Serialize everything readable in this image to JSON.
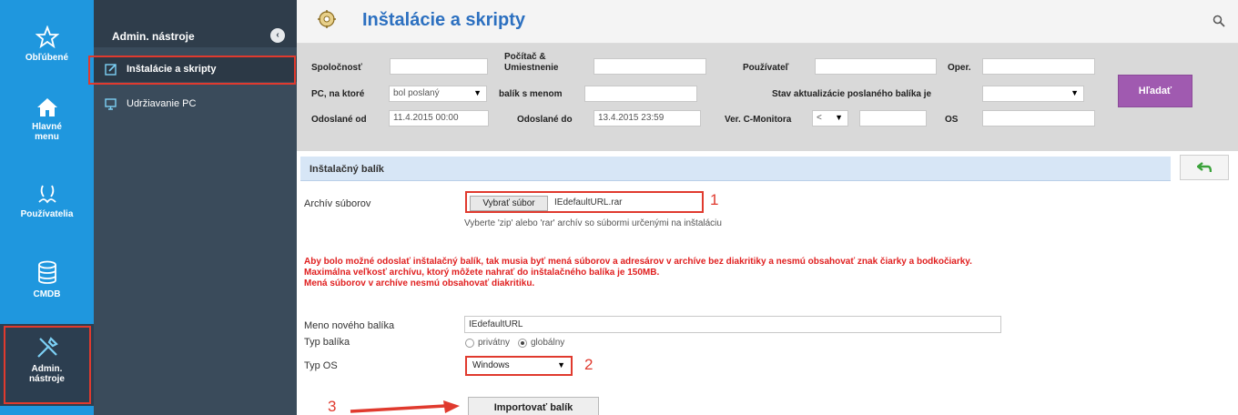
{
  "rail": {
    "items": [
      {
        "label": "Obľúbené",
        "icon": "star-icon"
      },
      {
        "label": "Hlavné menu",
        "icon": "home-icon"
      },
      {
        "label": "Používatelia",
        "icon": "users-icon"
      },
      {
        "label": "CMDB",
        "icon": "database-icon"
      },
      {
        "label": "Admin. nástroje",
        "icon": "tools-icon"
      }
    ]
  },
  "subnav": {
    "title": "Admin. nástroje",
    "collapse": "‹",
    "items": [
      {
        "label": "Inštalácie a skripty"
      },
      {
        "label": "Udržiavanie PC"
      }
    ]
  },
  "header": {
    "title": "Inštalácie a skripty"
  },
  "filters": {
    "company_label": "Spoločnosť",
    "computer_label": "Počítač &",
    "computer_label2": "Umiestnenie",
    "user_label": "Používateľ",
    "oper_label": "Oper.",
    "pc_label": "PC, na ktoré",
    "pc_value": "bol poslaný",
    "pkg_label": "balík s menom",
    "status_label": "Stav aktualizácie poslaného balíka je",
    "sent_from_label": "Odoslané od",
    "sent_from_value": "11.4.2015 00:00",
    "sent_to_label": "Odoslané do",
    "sent_to_value": "13.4.2015 23:59",
    "ver_label": "Ver. C-Monitora",
    "ver_op": "<",
    "os_label": "OS",
    "search_button": "Hľadať"
  },
  "section": {
    "title": "Inštalačný balík"
  },
  "form": {
    "archive_label": "Archív súborov",
    "file_button": "Vybrať súbor",
    "file_name": "IEdefaultURL.rar",
    "hint": "Vyberte 'zip' alebo 'rar' archív so súbormi určenými na inštaláciu",
    "warnings": [
      "Aby bolo možné odoslať inštalačný balík, tak musia byť mená súborov a adresárov v archíve bez diakritiky a nesmú obsahovať znak čiarky a bodkočiarky.",
      "Maximálna veľkosť archívu, ktorý môžete nahrať do inštalačného balíka je 150MB.",
      "Mená súborov v archíve nesmú obsahovať diakritiku."
    ],
    "pkg_name_label": "Meno nového balíka",
    "pkg_name_value": "IEdefaultURL",
    "pkg_type_label": "Typ balíka",
    "pkg_type_private": "privátny",
    "pkg_type_global": "globálny",
    "os_type_label": "Typ OS",
    "os_type_value": "Windows",
    "import_button": "Importovať balík"
  },
  "annotations": {
    "n1": "1",
    "n2": "2",
    "n3": "3"
  },
  "colors": {
    "accent": "#1f97de",
    "sidebar": "#3a4b5b",
    "title": "#2c70c0",
    "annotation": "#e03a2e",
    "search_button": "#a05ab0"
  }
}
